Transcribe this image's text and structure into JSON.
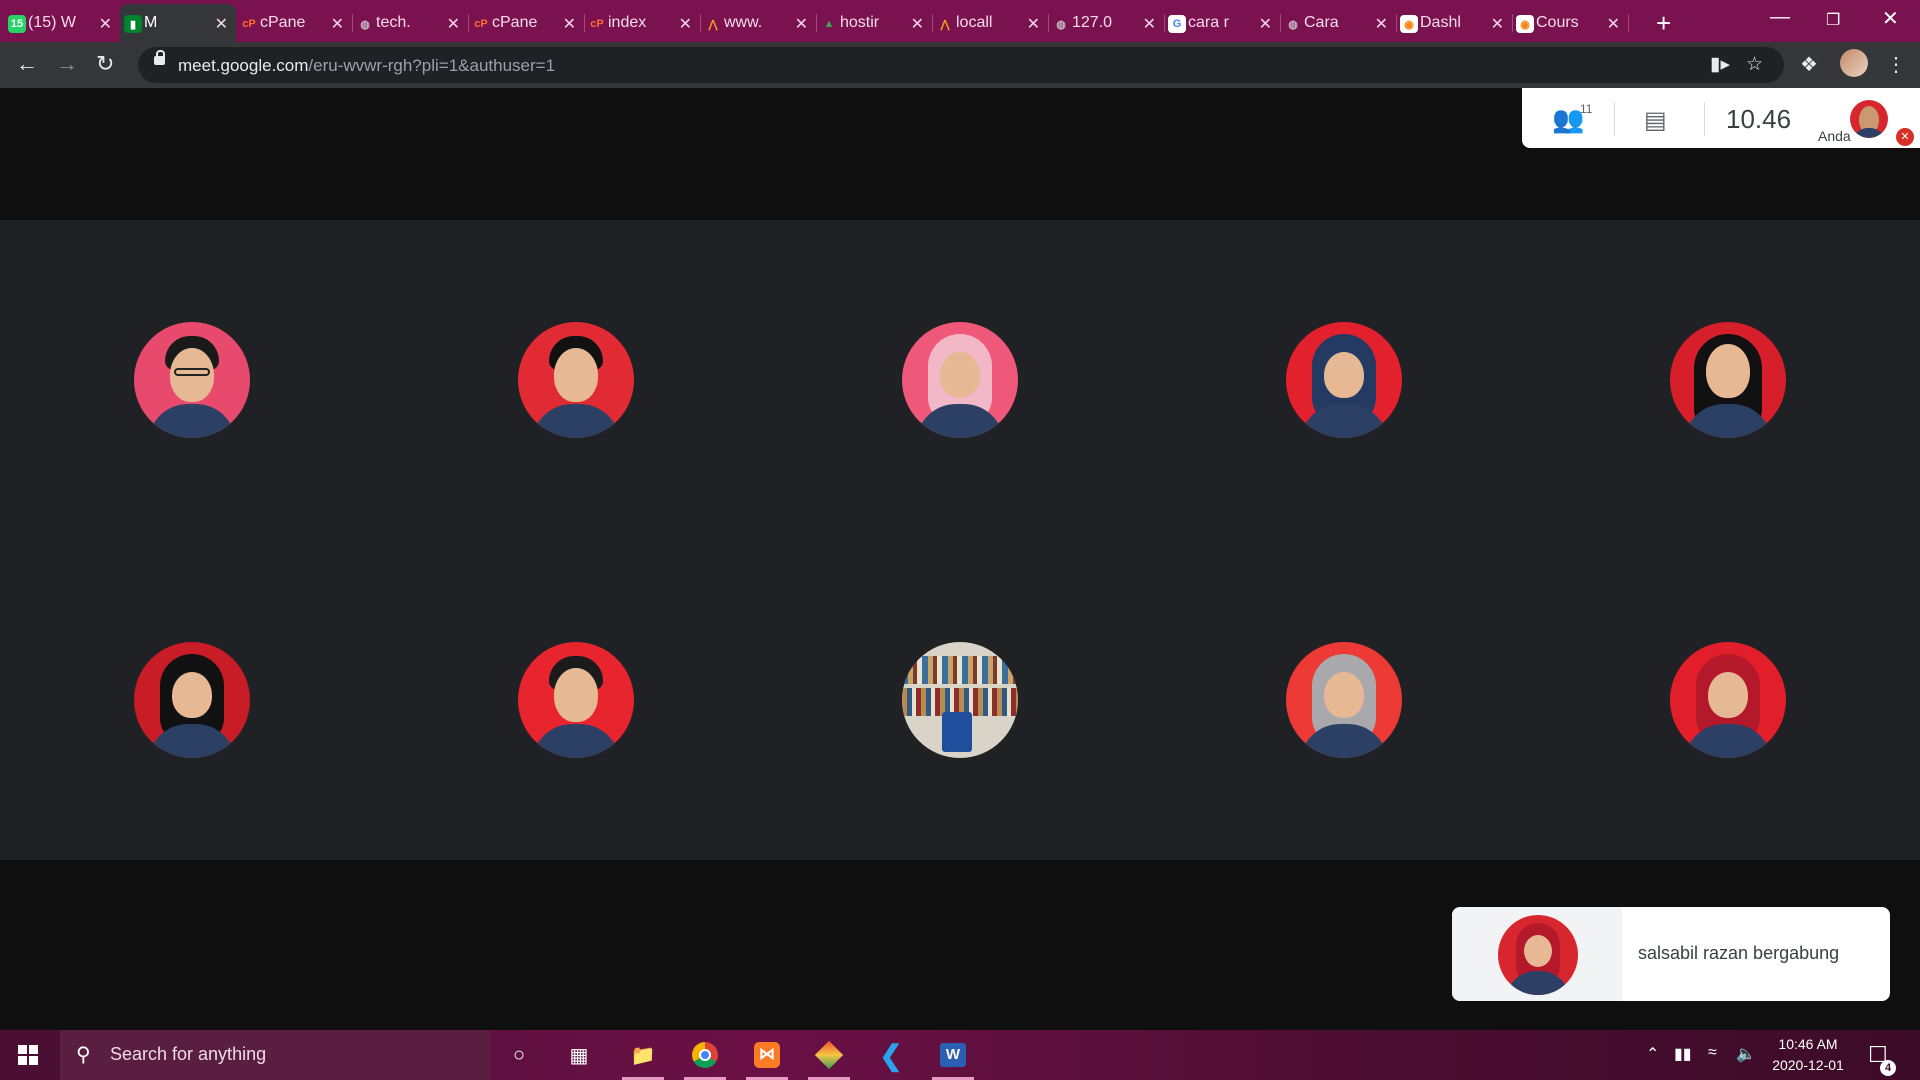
{
  "tabs": [
    {
      "title": "(15) W",
      "icon": "whatsapp-icon"
    },
    {
      "title": "M",
      "icon": "google-meet-icon",
      "active": true
    },
    {
      "title": "cPane",
      "icon": "cpanel-icon"
    },
    {
      "title": "tech.",
      "icon": "globe-icon"
    },
    {
      "title": "cPane",
      "icon": "cpanel-icon"
    },
    {
      "title": "index",
      "icon": "cpanel-icon"
    },
    {
      "title": "www.",
      "icon": "phpmyadmin-icon"
    },
    {
      "title": "hostir",
      "icon": "google-drive-icon"
    },
    {
      "title": "locall",
      "icon": "phpmyadmin-icon"
    },
    {
      "title": "127.0",
      "icon": "globe-icon"
    },
    {
      "title": "cara r",
      "icon": "google-icon"
    },
    {
      "title": "Cara",
      "icon": "globe-icon"
    },
    {
      "title": "Dashl",
      "icon": "moodle-icon"
    },
    {
      "title": "Cours",
      "icon": "moodle-icon"
    }
  ],
  "address": {
    "host": "meet.google.com",
    "path": "/eru-wvwr-rgh?pli=1&authuser=1"
  },
  "meet": {
    "participant_count": "11",
    "time": "10.46",
    "self_label": "Anda",
    "notification": "salsabil razan bergabung",
    "participants": [
      {
        "bg": "#e84a6e",
        "type": "man",
        "hair": "#1a1a1a",
        "glasses": true
      },
      {
        "bg": "#e22a35",
        "type": "man",
        "hair": "#111111"
      },
      {
        "bg": "#f0587a",
        "type": "hijab",
        "hijab": "#f3b8c8"
      },
      {
        "bg": "#e2202e",
        "type": "hijab",
        "hijab": "#243a62"
      },
      {
        "bg": "#d61f2a",
        "type": "woman",
        "hair": "#111111"
      },
      {
        "bg": "#c81c26",
        "type": "hijab",
        "hijab": "#111111"
      },
      {
        "bg": "#e8242f",
        "type": "man",
        "hair": "#1b1b1b"
      },
      {
        "bg": "#d8d4c8",
        "type": "room"
      },
      {
        "bg": "#ee3a35",
        "type": "hijab",
        "hijab": "#a9a9ad"
      },
      {
        "bg": "#e31e2b",
        "type": "hijab",
        "hijab": "#b3192a"
      }
    ]
  },
  "taskbar": {
    "search_placeholder": "Search for anything",
    "time": "10:46 AM",
    "date": "2020-12-01",
    "notification_count": "4"
  }
}
